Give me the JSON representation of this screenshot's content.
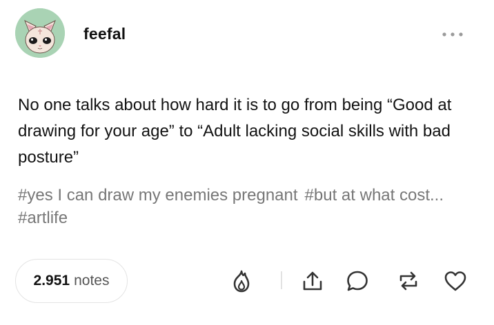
{
  "post": {
    "author": "feefal",
    "body": "No one talks about how hard it is to go from being “Good at drawing for your age” to “Adult lacking social skills with bad posture”",
    "tags": [
      "#yes I can draw my enemies pregnant",
      "#but at what cost...",
      "#artlife"
    ]
  },
  "footer": {
    "notes_count": "2.951",
    "notes_label": "notes"
  },
  "icons": {
    "avatar": "cat-avatar-icon",
    "more": "more-dots-icon",
    "blaze": "blaze-flame-icon",
    "share": "share-icon",
    "reply": "reply-bubble-icon",
    "reblog": "reblog-icon",
    "like": "heart-icon"
  },
  "colors": {
    "avatar_background": "#a9d3b4",
    "text": "#121212",
    "tags": "#777777",
    "icons": "#333333",
    "pill_border": "#e3e3e3"
  }
}
